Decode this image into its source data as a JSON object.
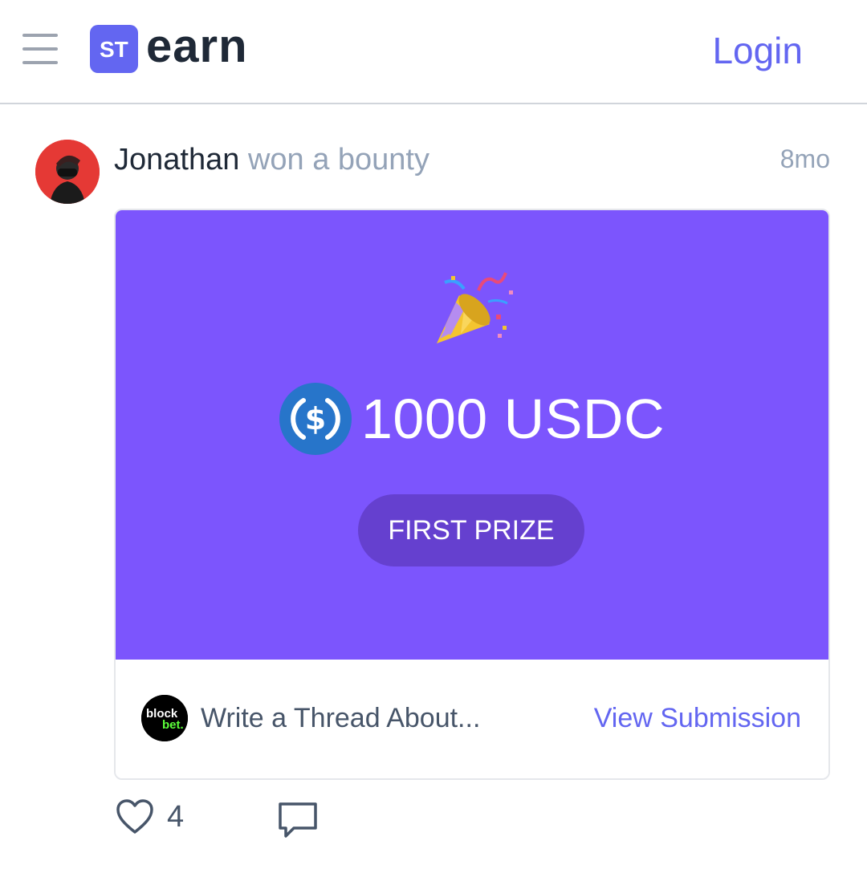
{
  "header": {
    "logo_text": "earn",
    "logo_mark_text": "ST",
    "login_label": "Login"
  },
  "feed": {
    "user_name": "Jonathan",
    "action_text": "won a bounty",
    "time_ago": "8mo"
  },
  "card": {
    "amount": "1000 USDC",
    "token": "USDC",
    "prize_label": "FIRST PRIZE",
    "sponsor_name": "blockbet",
    "listing_title": "Write a Thread About...",
    "view_label": "View Submission",
    "hero_color": "#7c55fd"
  },
  "actions": {
    "like_count": "4"
  },
  "icons": [
    "menu-icon",
    "logo-icon",
    "party-popper-icon",
    "usdc-coin-icon",
    "heart-icon",
    "comment-icon"
  ]
}
